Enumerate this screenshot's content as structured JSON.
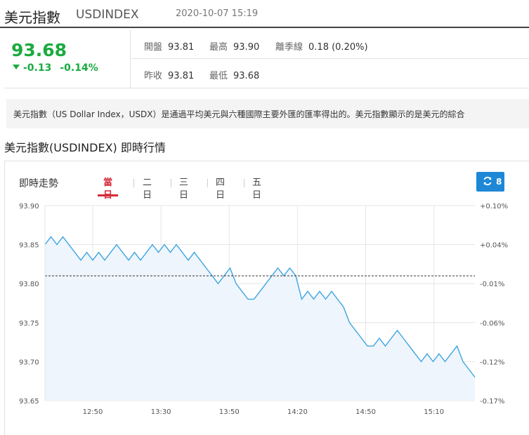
{
  "header": {
    "title": "美元指數",
    "symbol": "USDINDEX",
    "timestamp": "2020-10-07 15:19"
  },
  "quote": {
    "price": "93.68",
    "change": "-0.13",
    "change_pct": "-0.14%",
    "open_label": "開盤",
    "open_value": "93.81",
    "high_label": "最高",
    "high_value": "93.90",
    "deviation_label": "離季線",
    "deviation_value": "0.18 (0.20%)",
    "prev_close_label": "昨收",
    "prev_close_value": "93.81",
    "low_label": "最低",
    "low_value": "93.68"
  },
  "description": "美元指數（US Dollar Index，USDX）是通過平均美元與六種國際主要外匯的匯率得出的。美元指數顯示的是美元的綜合",
  "section_title": "美元指數(USDINDEX) 即時行情",
  "chart_card": {
    "title": "即時走勢",
    "tabs": [
      {
        "label": "當日",
        "active": true
      },
      {
        "label": "二日",
        "active": false
      },
      {
        "label": "三日",
        "active": false
      },
      {
        "label": "四日",
        "active": false
      },
      {
        "label": "五日",
        "active": false
      }
    ],
    "refresh_count": "8"
  },
  "colors": {
    "up": "#d62b3a",
    "down": "#1aab3f",
    "line": "#3ea5e0",
    "area": "#eef5fc",
    "button": "#1e88d6"
  },
  "chart_data": {
    "type": "area",
    "title": "",
    "xlabel": "",
    "ylabel": "",
    "ylim": [
      93.65,
      93.9
    ],
    "yticks": [
      "93.90",
      "93.85",
      "93.80",
      "93.75",
      "93.70",
      "93.65"
    ],
    "y2ticks": [
      "+0.10%",
      "+0.04%",
      "-0.01%",
      "-0.06%",
      "-0.12%",
      "-0.17%"
    ],
    "xticks": [
      "12:50",
      "13:30",
      "13:50",
      "14:20",
      "14:50",
      "15:10"
    ],
    "reference_line": 93.81,
    "grid": true,
    "values": [
      93.85,
      93.86,
      93.85,
      93.86,
      93.85,
      93.84,
      93.83,
      93.84,
      93.83,
      93.84,
      93.83,
      93.84,
      93.85,
      93.84,
      93.83,
      93.84,
      93.83,
      93.84,
      93.85,
      93.84,
      93.85,
      93.84,
      93.85,
      93.84,
      93.83,
      93.84,
      93.83,
      93.82,
      93.81,
      93.8,
      93.81,
      93.82,
      93.8,
      93.79,
      93.78,
      93.78,
      93.79,
      93.8,
      93.81,
      93.82,
      93.81,
      93.82,
      93.81,
      93.78,
      93.79,
      93.78,
      93.79,
      93.78,
      93.79,
      93.78,
      93.77,
      93.75,
      93.74,
      93.73,
      93.72,
      93.72,
      93.73,
      93.72,
      93.73,
      93.74,
      93.73,
      93.72,
      93.71,
      93.7,
      93.71,
      93.7,
      93.71,
      93.7,
      93.71,
      93.72,
      93.7,
      93.69,
      93.68
    ]
  }
}
